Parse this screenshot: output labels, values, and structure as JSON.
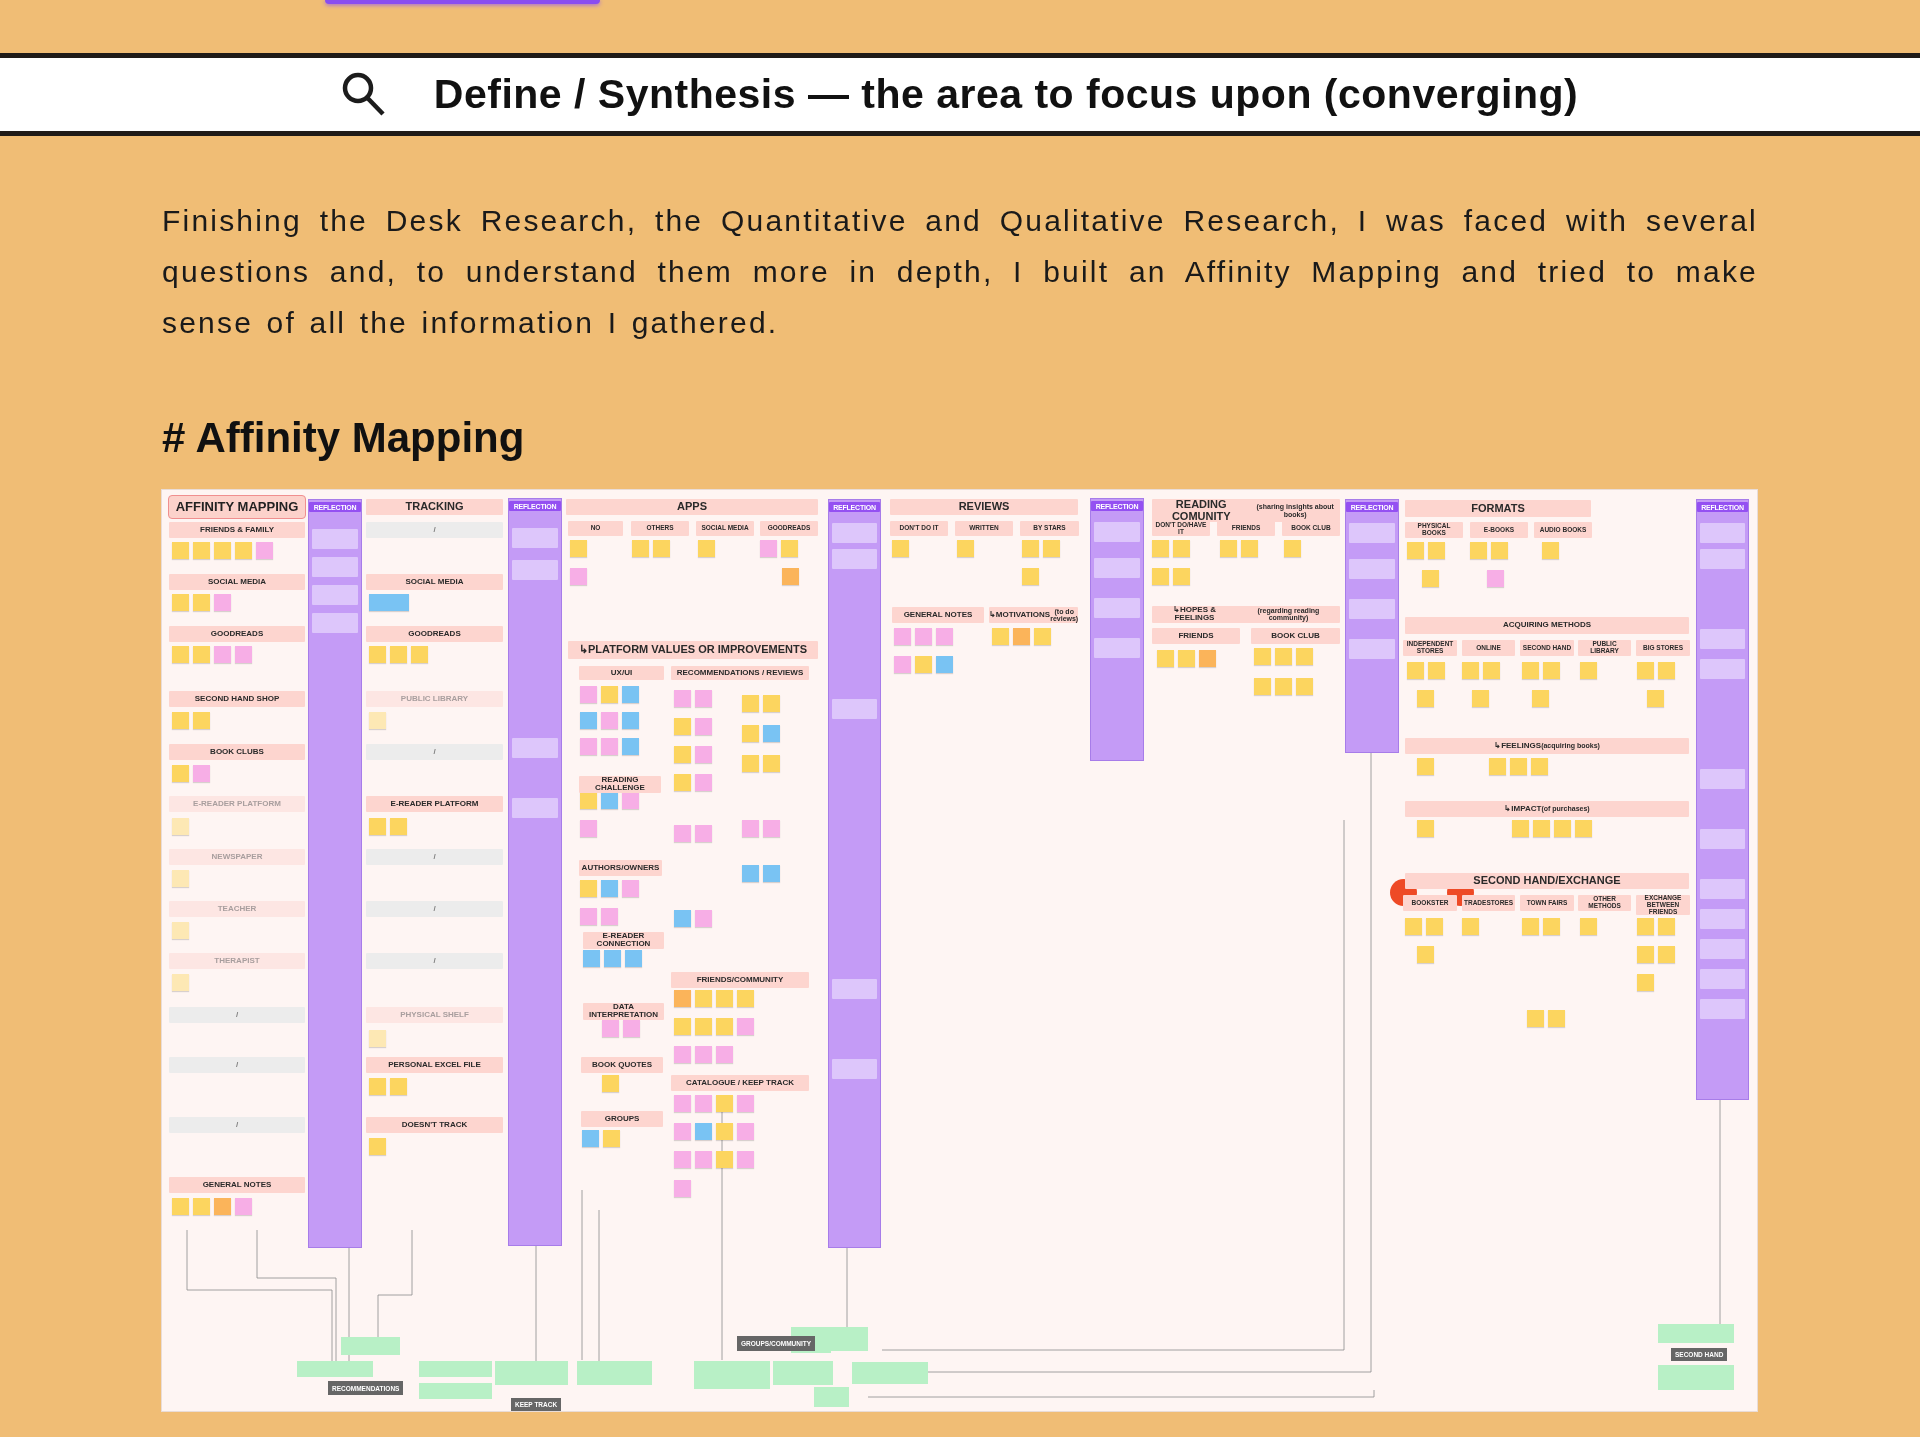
{
  "page": {
    "title": "Define / Synthesis — the area to focus upon (converging)",
    "intro": "Finishing the Desk Research, the Quantitative and Qualitative Research, I was faced with several questions and, to understand them more in depth, I built an Affinity Mapping and tried to make sense of all the information I gathered.",
    "section_heading": "# Affinity Mapping"
  },
  "board": {
    "labels": [
      {
        "text": "AFFINITY MAPPING",
        "kind": "title"
      },
      {
        "text": "FRIENDS & FAMILY",
        "kind": "header"
      },
      {
        "text": "SOCIAL MEDIA",
        "kind": "header"
      },
      {
        "text": "GOODREADS",
        "kind": "header"
      },
      {
        "text": "SECOND HAND SHOP",
        "kind": "header"
      },
      {
        "text": "BOOK CLUBS",
        "kind": "header"
      },
      {
        "text": "E-READER PLATFORM",
        "kind": "faint"
      },
      {
        "text": "NEWSPAPER",
        "kind": "faint"
      },
      {
        "text": "TEACHER",
        "kind": "faint"
      },
      {
        "text": "THERAPIST",
        "kind": "faint"
      },
      {
        "text": "/",
        "kind": "blank"
      },
      {
        "text": "/",
        "kind": "blank"
      },
      {
        "text": "/",
        "kind": "blank"
      },
      {
        "text": "GENERAL NOTES",
        "kind": "header"
      },
      {
        "text": "TRACKING",
        "kind": "section"
      },
      {
        "text": "/",
        "kind": "blank"
      },
      {
        "text": "SOCIAL MEDIA",
        "kind": "header"
      },
      {
        "text": "GOODREADS",
        "kind": "header"
      },
      {
        "text": "PUBLIC LIBRARY",
        "kind": "faint"
      },
      {
        "text": "/",
        "kind": "blank"
      },
      {
        "text": "E-READER PLATFORM",
        "kind": "header"
      },
      {
        "text": "/",
        "kind": "blank"
      },
      {
        "text": "/",
        "kind": "blank"
      },
      {
        "text": "/",
        "kind": "blank"
      },
      {
        "text": "PHYSICAL SHELF",
        "kind": "faint"
      },
      {
        "text": "PERSONAL EXCEL FILE",
        "kind": "header"
      },
      {
        "text": "DOESN'T TRACK",
        "kind": "header"
      },
      {
        "text": "APPS",
        "kind": "section"
      },
      {
        "text": "NO",
        "kind": "header"
      },
      {
        "text": "OTHERS",
        "kind": "header"
      },
      {
        "text": "SOCIAL MEDIA",
        "kind": "header"
      },
      {
        "text": "GOODREADS",
        "kind": "header"
      },
      {
        "text": "↳PLATFORM VALUES OR IMPROVEMENTS",
        "kind": "section"
      },
      {
        "text": "UX/UI",
        "kind": "header"
      },
      {
        "text": "RECOMMENDATIONS / REVIEWS",
        "kind": "header"
      },
      {
        "text": "READING CHALLENGE",
        "kind": "header"
      },
      {
        "text": "AUTHORS/OWNERS",
        "kind": "header"
      },
      {
        "text": "E-READER CONNECTION",
        "kind": "header"
      },
      {
        "text": "FRIENDS/COMMUNITY",
        "kind": "header"
      },
      {
        "text": "DATA INTERPRETATION",
        "kind": "header"
      },
      {
        "text": "BOOK QUOTES",
        "kind": "header"
      },
      {
        "text": "CATALOGUE / KEEP TRACK",
        "kind": "header"
      },
      {
        "text": "GROUPS",
        "kind": "header"
      },
      {
        "text": "REVIEWS",
        "kind": "section"
      },
      {
        "text": "DON'T DO IT",
        "kind": "header"
      },
      {
        "text": "WRITTEN",
        "kind": "header"
      },
      {
        "text": "BY STARS",
        "kind": "header"
      },
      {
        "text": "GENERAL NOTES",
        "kind": "header"
      },
      {
        "text": "↳MOTIVATIONS",
        "note": "(to do reviews)",
        "kind": "header"
      },
      {
        "text": "READING COMUNITY",
        "note": "(sharing insights about books)",
        "kind": "section"
      },
      {
        "text": "DON'T DO/HAVE IT",
        "kind": "header"
      },
      {
        "text": "FRIENDS",
        "kind": "header"
      },
      {
        "text": "BOOK CLUB",
        "kind": "header"
      },
      {
        "text": "↳HOPES & FEELINGS",
        "note": "(regarding reading community)",
        "kind": "header"
      },
      {
        "text": "FRIENDS",
        "kind": "header"
      },
      {
        "text": "BOOK CLUB",
        "kind": "header"
      },
      {
        "text": "FORMATS",
        "kind": "section"
      },
      {
        "text": "PHYSICAL BOOKS",
        "kind": "header"
      },
      {
        "text": "E-BOOKS",
        "kind": "header"
      },
      {
        "text": "AUDIO BOOKS",
        "kind": "header"
      },
      {
        "text": "ACQUIRING METHODS",
        "kind": "header"
      },
      {
        "text": "INDEPENDENT STORES",
        "kind": "header"
      },
      {
        "text": "ONLINE",
        "kind": "header"
      },
      {
        "text": "SECOND HAND",
        "kind": "header"
      },
      {
        "text": "PUBLIC LIBRARY",
        "kind": "header"
      },
      {
        "text": "BIG STORES",
        "kind": "header"
      },
      {
        "text": "↳FEELINGS",
        "note": "(acquiring books)",
        "kind": "header"
      },
      {
        "text": "↳IMPACT",
        "note": "(of purchases)",
        "kind": "header"
      },
      {
        "text": "SECOND HAND/EXCHANGE",
        "kind": "section"
      },
      {
        "text": "BOOKSTER",
        "kind": "header"
      },
      {
        "text": "TRADESTORES",
        "kind": "header"
      },
      {
        "text": "TOWN FAIRS",
        "kind": "header"
      },
      {
        "text": "OTHER METHODS",
        "kind": "header"
      },
      {
        "text": "EXCHANGE BETWEEN FRIENDS",
        "kind": "header"
      }
    ],
    "reflection_tags": [
      "REFLECTION",
      "REFLECTION",
      "REFLECTION",
      "REFLECTION",
      "REFLECTION",
      "REFLECTION"
    ],
    "tags": [
      "RECOMMENDATIONS",
      "KEEP TRACK",
      "GROUPS/COMMUNITY",
      "SECOND HAND"
    ]
  }
}
